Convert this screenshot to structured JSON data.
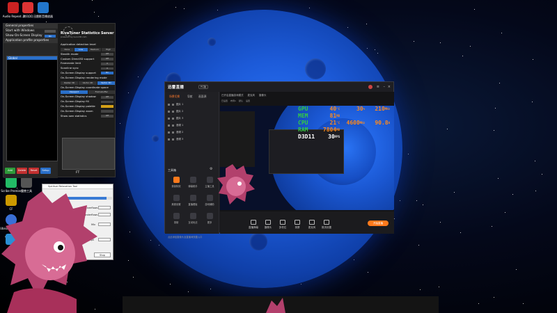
{
  "desktop_icons": [
    {
      "label": "Audio Repeat...",
      "color": "#c22"
    },
    {
      "label": "腾讯QQ",
      "color": "#d33"
    },
    {
      "label": "迅雷影音播放器",
      "color": "#27c"
    }
  ],
  "left_icons": [
    {
      "label": "Scribe Premier",
      "color": "#2b6"
    },
    {
      "label": "魔兽工具",
      "color": "#555"
    },
    {
      "label": "CF",
      "color": "#c90"
    },
    {
      "label": "Ubisoft Connect",
      "color": "#3a6fd6"
    },
    {
      "label": "",
      "color": "#2a8fd6"
    }
  ],
  "rtss": {
    "general_header": "General properties",
    "start_with_windows": "Start with Windows",
    "show_osd_label": "Show On-Screen Display",
    "show_osd_value": "On",
    "app_profile_header": "Application profile properties",
    "global_item": "Global",
    "buttons": [
      {
        "label": "Add",
        "color": "#2e9a3a"
      },
      {
        "label": "Delete",
        "color": "#c23030"
      },
      {
        "label": "Reset",
        "color": "#c23030"
      },
      {
        "label": "Setup",
        "color": "#2a6fc9"
      }
    ],
    "version": "7.3.3 Beta 3",
    "title": "RivaTuner Statistics Server",
    "subtitle": "powered by Guru3D.com",
    "detection_label": "Application detection level",
    "detection_options": [
      "None",
      "Low",
      "Medium",
      "High"
    ],
    "detection_selected": "Low",
    "options": [
      {
        "label": "Stealth mode",
        "value": "Off"
      },
      {
        "label": "Custom Direct3D support",
        "value": "Off"
      },
      {
        "label": "Framerate limit",
        "value": "0"
      },
      {
        "label": "Scanline sync",
        "value": "0"
      },
      {
        "label": "On-Screen Display support",
        "value": "On"
      },
      {
        "label": "On-Screen Display rendering mode",
        "value": ""
      }
    ],
    "rendering_options": [
      "Raster 3D",
      "Vector 2D",
      "Vector 3D"
    ],
    "rendering_selected": "Vector 3D",
    "options2": [
      {
        "label": "On-Screen Display coordinate space",
        "value": ""
      }
    ],
    "coord_options": [
      "Viewport",
      "Framebuffer"
    ],
    "coord_selected": "Viewport",
    "options3": [
      {
        "label": "On-Screen Display shadow",
        "value": "Off"
      },
      {
        "label": "On-Screen Display fill",
        "value": ""
      },
      {
        "label": "On-Screen Display palette",
        "value": ""
      },
      {
        "label": "On-Screen Display zoom",
        "value": ""
      },
      {
        "label": "Show own statistics",
        "value": "Off"
      }
    ],
    "fps_label": "FT"
  },
  "small_dialog": {
    "title": "Spiritual Relaxation Tool",
    "labels": [
      "Overflows",
      "underflows",
      "Mix",
      "Ampli"
    ],
    "progress": 0.88,
    "stop_label": "Stop"
  },
  "recorder": {
    "logo": "迅雷直播",
    "mode": "PC版",
    "side_tabs": [
      "场景切换",
      "导航",
      "画面源"
    ],
    "layers": [
      "图片 1",
      "图片 2",
      "图片 3",
      "音频 1",
      "音频 2",
      "音频 3"
    ],
    "tools_title": "工具箱",
    "tools": [
      {
        "label": "录制特效",
        "color": "#ff7a1c"
      },
      {
        "label": "弹幕助手",
        "color": "#3b3b42"
      },
      {
        "label": "主播工具",
        "color": "#3b3b42"
      },
      {
        "label": "美颜设置",
        "color": "#3b3b42"
      },
      {
        "label": "直播看板",
        "color": "#3b3b42"
      },
      {
        "label": "游戏辅助",
        "color": "#3b3b42"
      },
      {
        "label": "录制",
        "color": "#3b3b42"
      },
      {
        "label": "互动玩法",
        "color": "#3b3b42"
      },
      {
        "label": "更多",
        "color": "#3b3b42"
      }
    ],
    "footer": "点此添加摄像头及直播间快捷入口",
    "main_tabs": [
      "已开启直播游戏模式",
      "麦克风",
      "摄像头"
    ],
    "sub_tabs": [
      "已设置",
      "布局1",
      "默认",
      "设置"
    ],
    "overlay": [
      {
        "label": "GPU",
        "v1": "40",
        "u1": "°C",
        "v2": "30",
        "u2": "%",
        "v3": "210",
        "u3": "MHz"
      },
      {
        "label": "MEM",
        "v1": "81",
        "u1": "MB",
        "v2": "",
        "u2": "",
        "v3": "",
        "u3": ""
      },
      {
        "label": "CPU",
        "v1": "21",
        "u1": "°C",
        "v2": "4600",
        "u2": "MHz",
        "v3": "90.8",
        "u3": "W"
      },
      {
        "label": "RAM",
        "v1": "7804",
        "u1": "MB",
        "v2": "",
        "u2": "",
        "v3": "",
        "u3": ""
      },
      {
        "label": "D3D11",
        "v1": "30",
        "u1": "FPS",
        "v2": "",
        "u2": "",
        "v3": "",
        "u3": "",
        "white": true
      }
    ],
    "controls": [
      "直播弹幕",
      "摄像头",
      "多机位",
      "录屏",
      "麦克风",
      "推流设置"
    ],
    "start_label": "开始直播",
    "accent": "#ff7a1c"
  }
}
